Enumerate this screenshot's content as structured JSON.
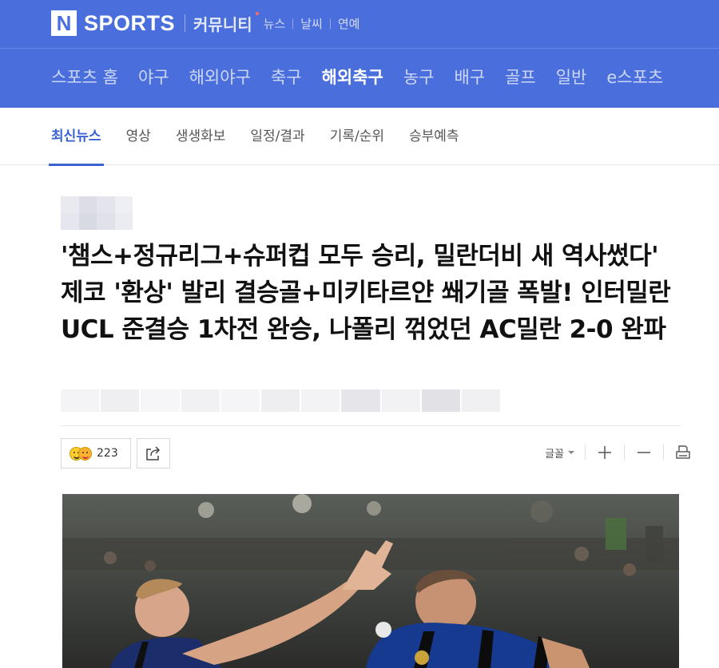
{
  "header": {
    "logo_letter": "N",
    "brand": "SPORTS",
    "community": "커뮤니티",
    "services": [
      "뉴스",
      "날씨",
      "연예"
    ]
  },
  "gnb": {
    "items": [
      "스포츠 홈",
      "야구",
      "해외야구",
      "축구",
      "해외축구",
      "농구",
      "배구",
      "골프",
      "일반",
      "e스포츠"
    ],
    "active": "해외축구"
  },
  "subnav": {
    "items": [
      "최신뉴스",
      "영상",
      "생생화보",
      "일정/결과",
      "기록/순위",
      "승부예측"
    ],
    "active": "최신뉴스"
  },
  "article": {
    "title": "'챔스+정규리그+슈퍼컵 모두 승리, 밀란더비 새 역사썼다' 제코 '환상' 발리 결승골+미키타르얀 쐐기골 폭발! 인터밀란 UCL 준결승 1차전 완승, 나폴리 꺾었던 AC밀란 2-0 완파",
    "reaction_count": "223"
  },
  "tools": {
    "font_label": "글꼴",
    "icons": [
      "plus-icon",
      "minus-icon",
      "print-icon"
    ]
  },
  "colors": {
    "header_bg": "#4a6fdc",
    "accent": "#3b62d3"
  }
}
